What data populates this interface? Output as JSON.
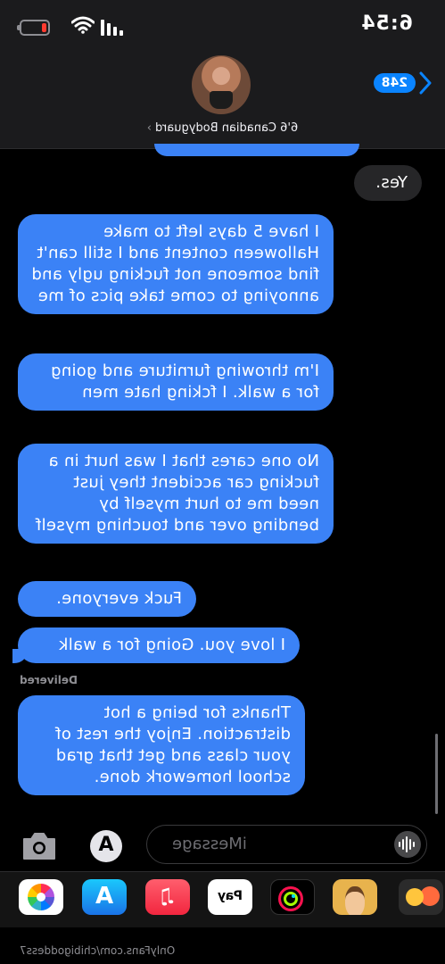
{
  "status_bar": {
    "time": "6:54"
  },
  "header": {
    "back_count": "248",
    "contact_name": "6'6 Canadian Bodyguard",
    "contact_chevron": "›"
  },
  "messages": [
    {
      "direction": "received",
      "text": "Yes."
    },
    {
      "direction": "sent",
      "text": "I have 5 days left to make Halloween content and I still can't find someone not fucking ugly and annoying to come take pics of me"
    },
    {
      "direction": "sent",
      "text": "I'm throwing furniture and going for a walk. I fcking hate men"
    },
    {
      "direction": "sent",
      "text": "No one cares that I was hurt in a fucking car accident they just need me to hurt myself by bending over and touching myself"
    },
    {
      "direction": "sent",
      "text": "Fuck everyone."
    },
    {
      "direction": "sent",
      "text": "I love you. Going for a walk"
    },
    {
      "direction": "sent",
      "text": "Thanks for being a hot distraction. Enjoy the rest of your class and get that grad school homework done."
    }
  ],
  "delivered_label": "Delivered",
  "input": {
    "placeholder": "iMessage",
    "store_glyph": "A"
  },
  "app_drawer": {
    "apps": [
      {
        "icon": "photos-icon"
      },
      {
        "icon": "app-store-icon",
        "glyph": "A"
      },
      {
        "icon": "music-icon",
        "glyph": "♫"
      },
      {
        "icon": "apple-pay-icon",
        "glyph": "Pay"
      },
      {
        "icon": "fitness-icon"
      },
      {
        "icon": "memoji-icon"
      },
      {
        "icon": "memoji-stickers-icon"
      }
    ]
  },
  "watermark": "OnlyFans.com/chibigoddess7",
  "colors": {
    "sent_bubble": "#3b82f6",
    "received_bubble": "#262628",
    "accent": "#0a84ff"
  }
}
